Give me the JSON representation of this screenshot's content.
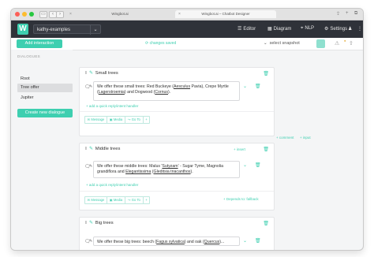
{
  "browser": {
    "url": "designer.wingbot.ai",
    "tabs": [
      {
        "title": "Wingbot.ai",
        "active": false
      },
      {
        "title": "Wingbot.ai – Chatbot Designer",
        "active": true
      }
    ]
  },
  "header": {
    "logo": "W",
    "project": "kathy-examples",
    "nav": [
      {
        "label": "Editor",
        "icon": "menu-icon"
      },
      {
        "label": "Diagram",
        "icon": "diagram-icon"
      },
      {
        "label": "NLP",
        "icon": "location-icon"
      },
      {
        "label": "Settings",
        "icon": "gear-icon"
      }
    ]
  },
  "toolbar": {
    "add_interaction": "Add interaction",
    "status": "changes saved",
    "snapshot": "select snapshot"
  },
  "sidebar": {
    "heading": "DIALOGUES",
    "items": [
      {
        "label": "Root",
        "active": false
      },
      {
        "label": "Tree offer",
        "active": true
      },
      {
        "label": "Jupiter",
        "active": false
      }
    ],
    "create_button": "Create new dialogue"
  },
  "cards": [
    {
      "title": "Small trees",
      "message_parts": [
        "We offer these small trees: Red Buckeye (",
        "Aesculus",
        " Pavia), Crepe Myrtle (",
        "Lagerstroemia",
        ") and Dogwood (",
        "Cornus",
        ")."
      ],
      "quick_reply": "+ add a quick reply/intent handler",
      "buttons": [
        "Message",
        "Media",
        "Go To",
        "+"
      ]
    },
    {
      "title": "Middle trees",
      "message_parts": [
        "We offer these middle trees: Malus '",
        "Sutyzam",
        "' - Sugar Tyme, Magnolia grandiflora and ",
        "Elegantissima",
        " (",
        "Gleditsia triacanthos",
        ")."
      ],
      "quick_reply": "+ add a quick reply/intent handler",
      "buttons": [
        "Message",
        "Media",
        "Go To",
        "+"
      ],
      "insert": "+ insert",
      "comment": "+ comment",
      "input": "+ input",
      "fallback": "+ Depends to: fallback"
    },
    {
      "title": "Big trees",
      "message_parts": [
        "We offer these big trees: beech (",
        "Fagus sylvatica",
        ") and oak (",
        "Quercus",
        ")..."
      ]
    }
  ]
}
